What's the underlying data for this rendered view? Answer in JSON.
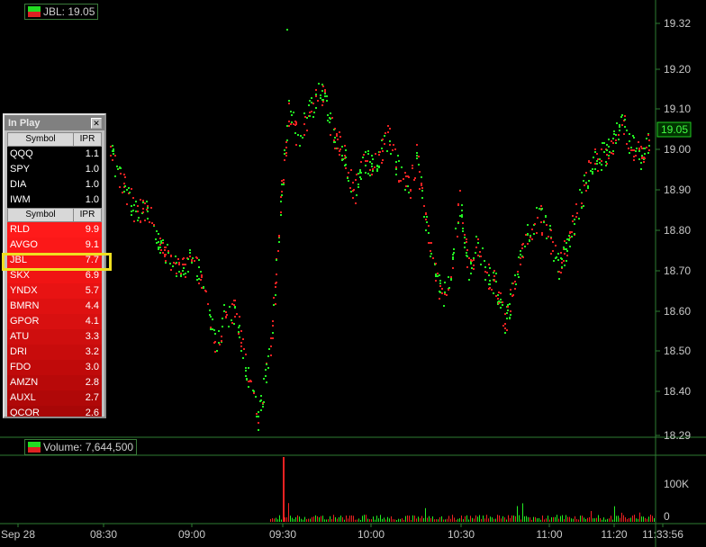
{
  "price_header": {
    "label": "JBL: 19.05",
    "swatch_up": "#22dd22",
    "swatch_down": "#dd2222"
  },
  "volume_header": {
    "label": "Volume: 7,644,500"
  },
  "price_axis": {
    "ticks": [
      "19.32",
      "19.20",
      "19.10",
      "19.00",
      "18.90",
      "18.80",
      "18.70",
      "18.60",
      "18.50",
      "18.40",
      "18.29"
    ],
    "current": "19.05"
  },
  "volume_axis": {
    "ticks": [
      "100K",
      "0"
    ]
  },
  "time_axis": {
    "labels": [
      "Sep 28",
      "08:30",
      "09:00",
      "09:30",
      "10:00",
      "10:30",
      "11:00",
      "11:20",
      "11:33:56"
    ]
  },
  "inplay": {
    "title": "In Play",
    "col_symbol": "Symbol",
    "col_ipr": "IPR",
    "index_rows": [
      {
        "symbol": "QQQ",
        "ipr": "1.1"
      },
      {
        "symbol": "SPY",
        "ipr": "1.0"
      },
      {
        "symbol": "DIA",
        "ipr": "1.0"
      },
      {
        "symbol": "IWM",
        "ipr": "1.0"
      }
    ],
    "stock_rows": [
      {
        "symbol": "RLD",
        "ipr": "9.9",
        "color": "#ff1a1a"
      },
      {
        "symbol": "AVGO",
        "ipr": "9.1",
        "color": "#fb1818"
      },
      {
        "symbol": "JBL",
        "ipr": "7.7",
        "color": "#f51616"
      },
      {
        "symbol": "SKX",
        "ipr": "6.9",
        "color": "#f01414"
      },
      {
        "symbol": "YNDX",
        "ipr": "5.7",
        "color": "#e81313"
      },
      {
        "symbol": "BMRN",
        "ipr": "4.4",
        "color": "#df1111"
      },
      {
        "symbol": "GPOR",
        "ipr": "4.1",
        "color": "#d81010"
      },
      {
        "symbol": "ATU",
        "ipr": "3.3",
        "color": "#cf0e0e"
      },
      {
        "symbol": "DRI",
        "ipr": "3.2",
        "color": "#c80c0c"
      },
      {
        "symbol": "FDO",
        "ipr": "3.0",
        "color": "#c00a0a"
      },
      {
        "symbol": "AMZN",
        "ipr": "2.8",
        "color": "#b80909"
      },
      {
        "symbol": "AUXL",
        "ipr": "2.7",
        "color": "#b00808"
      },
      {
        "symbol": "QCOR",
        "ipr": "2.6",
        "color": "#a80707"
      }
    ]
  },
  "colors": {
    "up": "#22ee22",
    "down": "#ee2222",
    "axis": "#2e7d32",
    "highlight": "#f0e020"
  }
}
